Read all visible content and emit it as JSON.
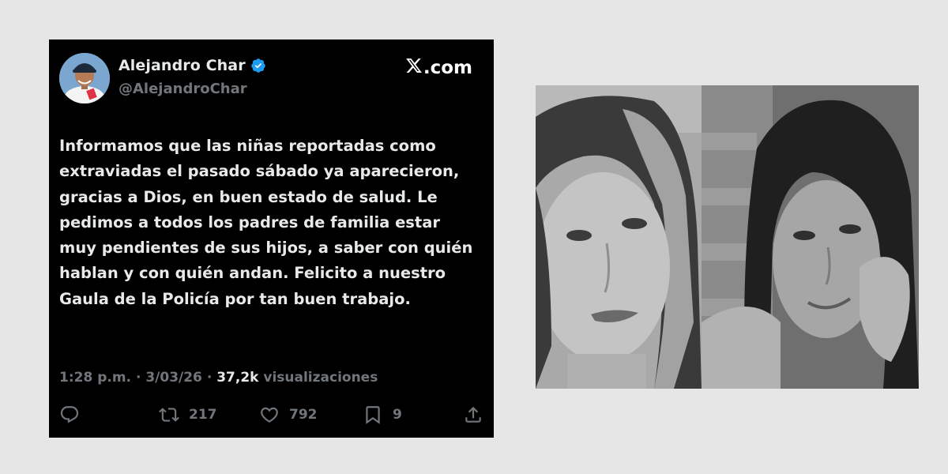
{
  "tweet": {
    "display_name": "Alejandro Char",
    "handle": "@AlejandroChar",
    "site": ".com",
    "body": "Informamos que las niñas reportadas como extraviadas el pasado sábado ya aparecieron, gracias a Dios, en buen estado de salud. Le pedimos a todos los padres de familia estar muy pendientes de sus hijos, a saber con quién hablan y con quién andan. Felicito a nuestro Gaula de la Policía por tan buen trabajo.",
    "time": "1:28 p.m.",
    "date": "3/03/26",
    "separator": "·",
    "views_count": "37,2k",
    "views_label": "visualizaciones",
    "retweets": "217",
    "likes": "792",
    "bookmarks": "9"
  },
  "colors": {
    "card_bg": "#000000",
    "text": "#e7e9ea",
    "muted": "#71767b",
    "verified": "#1d9bf0",
    "page_bg": "#e6e6e6"
  },
  "icons": [
    "verified-badge-icon",
    "x-logo-icon",
    "reply-icon",
    "retweet-icon",
    "like-icon",
    "bookmark-icon",
    "share-icon"
  ]
}
